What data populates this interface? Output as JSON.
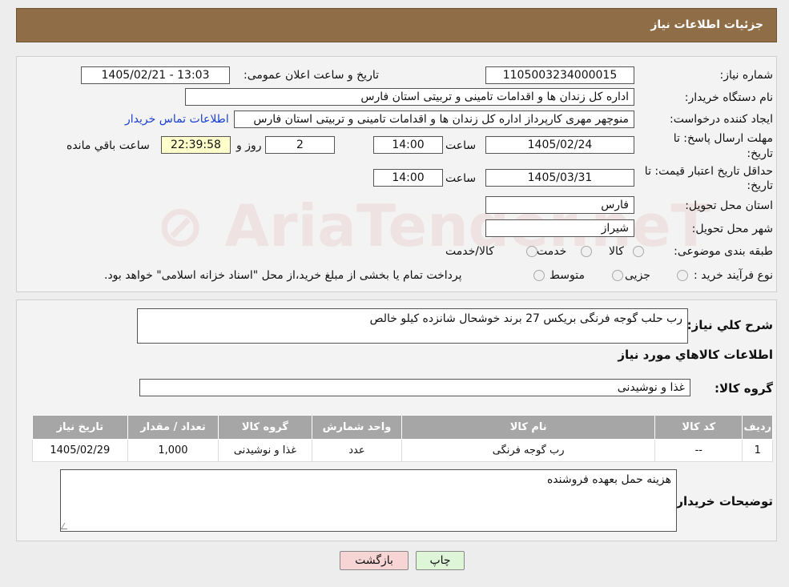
{
  "header": {
    "title": "جزئیات اطلاعات نیاز"
  },
  "form": {
    "need_number_label": "شماره نیاز:",
    "need_number": "1105003234000015",
    "announce_label": "تاریخ و ساعت اعلان عمومی:",
    "announce_value": "1405/02/21 - 13:03",
    "buyer_label": "نام دستگاه خریدار:",
    "buyer_value": "اداره کل زندان ها و اقدامات تامینی و تربیتی استان فارس",
    "creator_label": "ایجاد کننده درخواست:",
    "creator_value": "منوچهر  مهری  کارپرداز اداره کل زندان ها و اقدامات تامینی و تربیتی استان فارس",
    "contact_link": "اطلاعات تماس خریدار",
    "deadline_label_1": "مهلت ارسال پاسخ: تا",
    "deadline_label_2": "تاریخ:",
    "deadline_date": "1405/02/24",
    "time_label": "ساعت",
    "deadline_time": "14:00",
    "days_value": "2",
    "days_label": "روز و",
    "remaining_time": "22:39:58",
    "remaining_label": "ساعت باقي مانده",
    "validity_label_1": "حداقل تاریخ اعتبار قیمت: تا",
    "validity_label_2": "تاریخ:",
    "validity_date": "1405/03/31",
    "validity_time": "14:00",
    "province_label": "استان محل تحویل:",
    "province_value": "فارس",
    "city_label": "شهر محل تحویل:",
    "city_value": "شیراز",
    "category_label": "طبقه بندی موضوعی:",
    "category_options": [
      "کالا",
      "خدمت",
      "کالا/خدمت"
    ],
    "process_label": "نوع فرآیند خرید :",
    "process_options": [
      "جزیی",
      "متوسط"
    ],
    "process_note": "پرداخت تمام یا بخشی از مبلغ خرید،از محل \"اسناد خزانه اسلامی\" خواهد بود."
  },
  "details": {
    "summary_label": "شرح کلي نياز:",
    "summary_value": "رب حلب گوجه فرنگی بریکس 27 برند خوشحال شانزده کیلو خالص",
    "goods_title": "اطلاعات کالاهاي مورد نياز",
    "group_label": "گروه کالا:",
    "group_value": "غذا و نوشیدنی",
    "table": {
      "headers": [
        "رديف",
        "کد کالا",
        "نام کالا",
        "واحد شمارش",
        "گروه کالا",
        "تعداد / مقدار",
        "تاريخ نياز"
      ],
      "rows": [
        [
          "1",
          "--",
          "رب گوجه فرنگی",
          "عدد",
          "غذا و نوشیدنی",
          "1,000",
          "1405/02/29"
        ]
      ]
    },
    "buyer_notes_label": "توضیحات خریدار:",
    "buyer_notes_value": "هزینه حمل بعهده فروشنده"
  },
  "buttons": {
    "print": "چاپ",
    "back": "بازگشت"
  },
  "colors": {
    "header": "#8f6e47",
    "back_button": "#f7d5d5",
    "print_button": "#dff5d8",
    "link": "#1a3fd6"
  }
}
